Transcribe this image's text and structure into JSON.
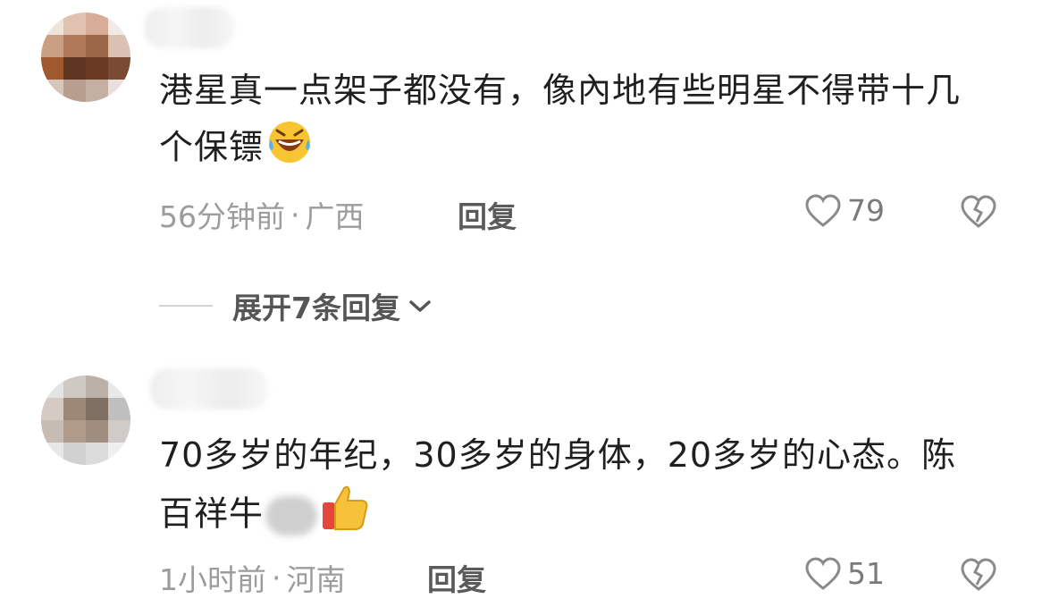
{
  "comments": [
    {
      "text": "港星真一点架子都没有，像內地有些明星不得带十几个保镖",
      "emoji_icon": "laughing-tears-emoji",
      "time": "56分钟前",
      "separator": "·",
      "location": "广西",
      "reply_label": "回复",
      "likes": "79"
    },
    {
      "text": "70多岁的年纪，30多岁的身体，20多岁的心态。陈百祥牛",
      "emoji_icon": "thumbs-up-emoji",
      "time": "1小时前",
      "separator": "·",
      "location": "河南",
      "reply_label": "回复",
      "likes": "51"
    }
  ],
  "expand_replies_label": "展开7条回复",
  "colors": {
    "text": "#1f1f1f",
    "meta": "#9c9c9c",
    "icon": "#8a8a8a"
  }
}
